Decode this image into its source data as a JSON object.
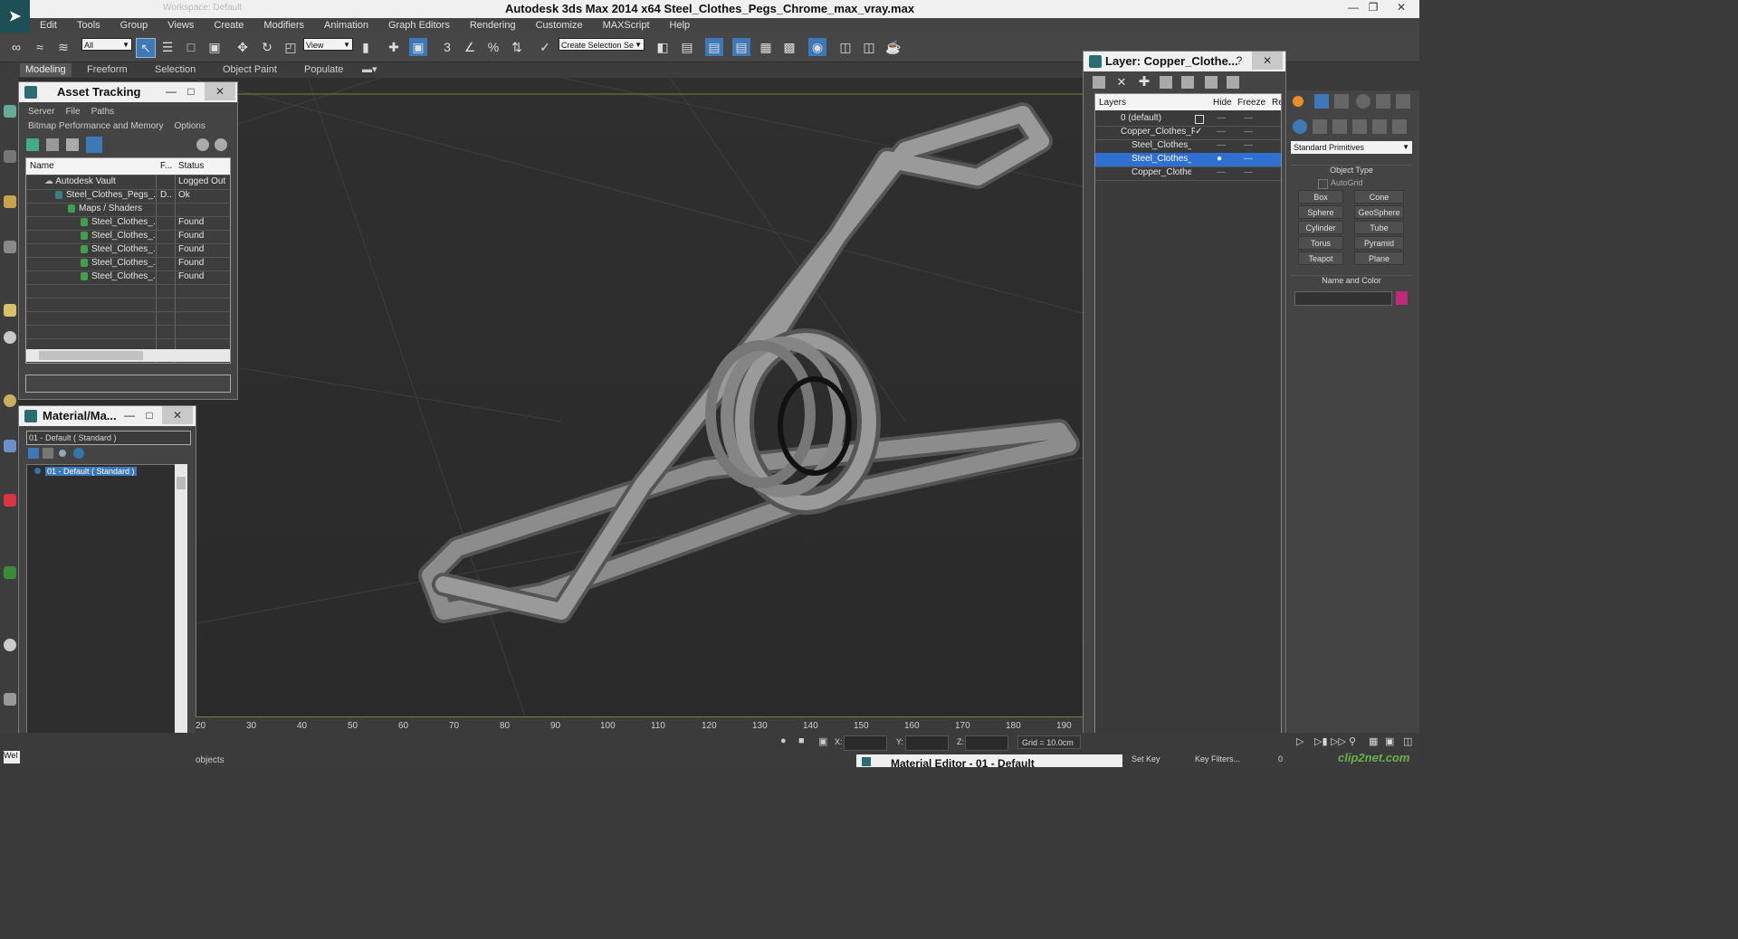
{
  "window": {
    "title": "Autodesk 3ds Max  2014 x64      Steel_Clothes_Pegs_Chrome_max_vray.max",
    "workspace": "Workspace: Default"
  },
  "menu": [
    "Edit",
    "Tools",
    "Group",
    "Views",
    "Create",
    "Modifiers",
    "Animation",
    "Graph Editors",
    "Rendering",
    "Customize",
    "MAXScript",
    "Help"
  ],
  "toolbar": {
    "filter_select": "All",
    "coord_select": "View",
    "selection_set": "Create Selection Se"
  },
  "ribbon": {
    "tabs": [
      "Modeling",
      "Freeform",
      "Selection",
      "Object Paint",
      "Populate"
    ]
  },
  "asset_tracking": {
    "title": "Asset Tracking",
    "menu": [
      "Server",
      "File",
      "Paths"
    ],
    "menu2": [
      "Bitmap Performance and Memory",
      "Options"
    ],
    "columns": [
      "Name",
      "F...",
      "Status"
    ],
    "rows": [
      {
        "name": "Autodesk Vault",
        "f": "",
        "status": "Logged Out"
      },
      {
        "name": "Steel_Clothes_Pegs_...",
        "f": "D..",
        "status": "Ok"
      },
      {
        "name": "Maps / Shaders",
        "f": "",
        "status": ""
      },
      {
        "name": "Steel_Clothes_...",
        "f": "",
        "status": "Found"
      },
      {
        "name": "Steel_Clothes_...",
        "f": "",
        "status": "Found"
      },
      {
        "name": "Steel_Clothes_...",
        "f": "",
        "status": "Found"
      },
      {
        "name": "Steel_Clothes_...",
        "f": "",
        "status": "Found"
      },
      {
        "name": "Steel_Clothes_...",
        "f": "",
        "status": "Found"
      }
    ]
  },
  "material_map": {
    "title": "Material/Ma...",
    "field": "01 - Default  ( Standard )",
    "tree_item": "01 - Default  ( Standard )"
  },
  "layer_panel": {
    "title": "Layer: Copper_Clothe...",
    "help": "?",
    "columns": [
      "Layers",
      "Hide",
      "Freeze",
      "Re"
    ],
    "rows": [
      {
        "name": "0 (default)"
      },
      {
        "name": "Copper_Clothes_Pe"
      },
      {
        "name": "Steel_Clothes_Pe"
      },
      {
        "name": "Steel_Clothes_P"
      },
      {
        "name": "Copper_Clothes_"
      }
    ]
  },
  "command_panel": {
    "dropdown": "Standard Primitives",
    "object_type_label": "Object Type",
    "autogrid": "AutoGrid",
    "buttons": [
      "Box",
      "Cone",
      "Sphere",
      "GeoSphere",
      "Cylinder",
      "Tube",
      "Torus",
      "Pyramid",
      "Teapot",
      "Plane"
    ],
    "name_color_label": "Name and Color",
    "swatch_color": "#c0287a"
  },
  "timeline": {
    "ticks": [
      "20",
      "30",
      "40",
      "50",
      "60",
      "70",
      "80",
      "90",
      "100",
      "110",
      "120",
      "130",
      "140",
      "150",
      "160",
      "170",
      "180",
      "190"
    ]
  },
  "status": {
    "x_label": "X:",
    "y_label": "Y:",
    "z_label": "Z:",
    "grid": "Grid = 10.0cm",
    "set_key": "Set Key",
    "key_filters": "Key Filters...",
    "frame": "0",
    "objects": "objects",
    "welcome": "Wel"
  },
  "material_editor_bar": {
    "title": "Material Editor - 01 - Default"
  },
  "watermark": "clip2net.com"
}
